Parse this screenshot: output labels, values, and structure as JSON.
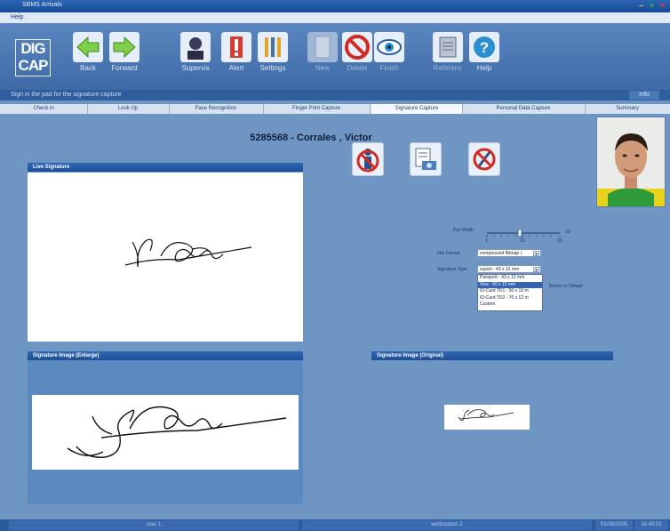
{
  "window": {
    "title": "SBMS Arrivals"
  },
  "menu": {
    "help": "Help"
  },
  "logo": {
    "line1": "DIG",
    "line2": "CAP"
  },
  "toolbar": {
    "back": "Back",
    "forward": "Forward",
    "supervis": "Supervis",
    "alert": "Alert",
    "settings": "Settings",
    "new": "New",
    "delete": "Delete",
    "finish": "Finish",
    "reference": "Referenc",
    "help": "Help"
  },
  "status": {
    "message": "Sign in the pad for the signature capture",
    "info": "Info"
  },
  "tabs": [
    "Check in",
    "Look Up",
    "Face Recognition",
    "Finger Print Capture",
    "Signature Capture",
    "Personal Data Capture",
    "Summary"
  ],
  "person": {
    "name": "5285568 - Corrales , Victor"
  },
  "panels": {
    "live": "Live Signature",
    "enlarge": "Signature Image (Enlarge)",
    "original": "Signature Image (Original)"
  },
  "options": {
    "pen_width_label": "Pen Width",
    "pen_scale_min": "1",
    "pen_scale_mid": "10",
    "pen_scale_mid2": "20",
    "pen_scale_max": "10",
    "file_format_label": "File Format",
    "file_format_value": "compressed Bitmap (",
    "signature_type_label": "Signature Type",
    "signature_type_value": "ssport - 43 x 12 mm",
    "signature_type_options": [
      "Passport - 43 x 12 mm",
      "Visa - 50 x 12 mm",
      "ID-Card TD1 - 50 x 10 m",
      "ID-Card TD2 - 70 x 12 m",
      "Custom"
    ],
    "selected_index": 1,
    "return_default": "Return to Default"
  },
  "footer": {
    "user": "user 1",
    "workstation": "workstation 2",
    "date": "01/08/2005",
    "time": "16:40:02"
  }
}
